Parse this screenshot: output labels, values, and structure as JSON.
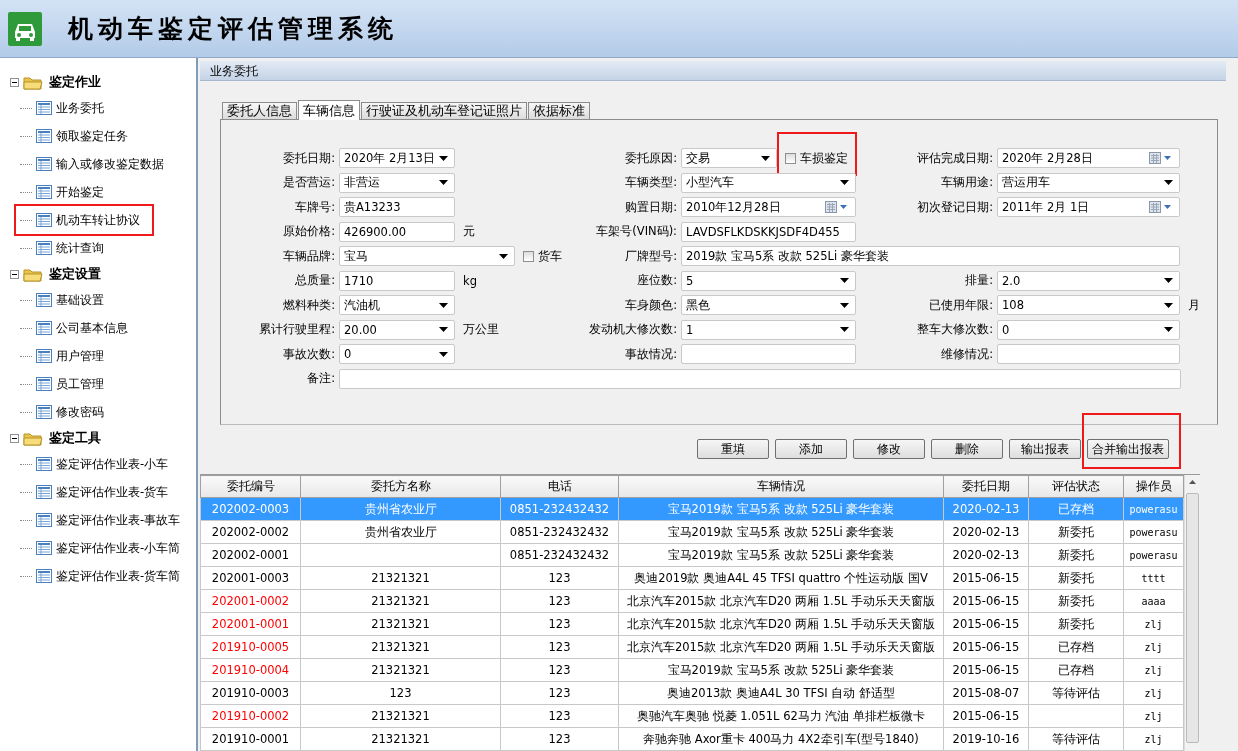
{
  "app": {
    "title": "机动车鉴定评估管理系统"
  },
  "sidebar": {
    "groups": [
      {
        "label": "鉴定作业",
        "expanded": true,
        "children": [
          {
            "label": "业务委托",
            "highlighted": false
          },
          {
            "label": "领取鉴定任务",
            "highlighted": false
          },
          {
            "label": "输入或修改鉴定数据",
            "highlighted": false
          },
          {
            "label": "开始鉴定",
            "highlighted": false
          },
          {
            "label": "机动车转让协议",
            "highlighted": true
          },
          {
            "label": "统计查询",
            "highlighted": false
          }
        ]
      },
      {
        "label": "鉴定设置",
        "expanded": true,
        "children": [
          {
            "label": "基础设置",
            "highlighted": false
          },
          {
            "label": "公司基本信息",
            "highlighted": false
          },
          {
            "label": "用户管理",
            "highlighted": false
          },
          {
            "label": "员工管理",
            "highlighted": false
          },
          {
            "label": "修改密码",
            "highlighted": false
          }
        ]
      },
      {
        "label": "鉴定工具",
        "expanded": true,
        "children": [
          {
            "label": "鉴定评估作业表-小车",
            "highlighted": false
          },
          {
            "label": "鉴定评估作业表-货车",
            "highlighted": false
          },
          {
            "label": "鉴定评估作业表-事故车",
            "highlighted": false
          },
          {
            "label": "鉴定评估作业表-小车简",
            "highlighted": false
          },
          {
            "label": "鉴定评估作业表-货车简",
            "highlighted": false
          }
        ]
      }
    ]
  },
  "panel": {
    "title": "业务委托",
    "tabs": [
      {
        "label": "委托人信息",
        "selected": false
      },
      {
        "label": "车辆信息",
        "selected": true
      },
      {
        "label": "行驶证及机动车登记证照片",
        "selected": false
      },
      {
        "label": "依据标准",
        "selected": false
      }
    ],
    "form": [
      [
        {
          "label": "委托日期:",
          "kind": "combo",
          "value": "2020年 2月13日"
        },
        {
          "label": "委托原因:",
          "kind": "combo",
          "value": "交易",
          "checkbox": {
            "label": "车损鉴定",
            "checked": false,
            "highlighted": true
          }
        },
        {
          "label": "评估完成日期:",
          "kind": "date",
          "value": "2020年 2月28日"
        }
      ],
      [
        {
          "label": "是否营运:",
          "kind": "combo",
          "value": "非营运"
        },
        {
          "label": "车辆类型:",
          "kind": "combo",
          "value": "小型汽车"
        },
        {
          "label": "车辆用途:",
          "kind": "combo",
          "value": "营运用车"
        }
      ],
      [
        {
          "label": "车牌号:",
          "kind": "text",
          "value": "贵A13233"
        },
        {
          "label": "购置日期:",
          "kind": "date",
          "value": "2010年12月28日"
        },
        {
          "label": "初次登记日期:",
          "kind": "date",
          "value": "2011年 2月 1日"
        }
      ],
      [
        {
          "label": "原始价格:",
          "kind": "text",
          "value": "426900.00",
          "unit": "元"
        },
        {
          "label": "车架号(VIN码):",
          "kind": "text",
          "value": "LAVDSFLKDSKKJSDF4D455"
        }
      ],
      [
        {
          "label": "车辆品牌:",
          "kind": "combo",
          "value": "宝马",
          "checkbox": {
            "label": "货车",
            "checked": false,
            "highlighted": false
          }
        },
        {
          "label": "厂牌型号:",
          "kind": "text",
          "value": "2019款 宝马5系 改款 525Li 豪华套装"
        }
      ],
      [
        {
          "label": "总质量:",
          "kind": "text",
          "value": "1710",
          "unit": "kg"
        },
        {
          "label": "座位数:",
          "kind": "combo",
          "value": "5"
        },
        {
          "label": "排量:",
          "kind": "combo",
          "value": "2.0"
        }
      ],
      [
        {
          "label": "燃料种类:",
          "kind": "combo",
          "value": "汽油机"
        },
        {
          "label": "车身颜色:",
          "kind": "combo",
          "value": "黑色"
        },
        {
          "label": "已使用年限:",
          "kind": "combo",
          "value": "108",
          "unit": "月"
        }
      ],
      [
        {
          "label": "累计行驶里程:",
          "kind": "combo",
          "value": "20.00",
          "unit": "万公里"
        },
        {
          "label": "发动机大修次数:",
          "kind": "combo",
          "value": "1"
        },
        {
          "label": "整车大修次数:",
          "kind": "combo",
          "value": "0"
        }
      ],
      [
        {
          "label": "事故次数:",
          "kind": "combo",
          "value": "0"
        },
        {
          "label": "事故情况:",
          "kind": "text"
        },
        {
          "label": "维修情况:",
          "kind": "text"
        }
      ],
      [
        {
          "label": "备注:",
          "kind": "text"
        }
      ]
    ],
    "buttons": [
      {
        "label": "重填",
        "highlighted": false
      },
      {
        "label": "添加",
        "highlighted": false
      },
      {
        "label": "修改",
        "highlighted": false
      },
      {
        "label": "删除",
        "highlighted": false
      },
      {
        "label": "输出报表",
        "highlighted": false
      },
      {
        "label": "合并输出报表",
        "highlighted": true
      }
    ],
    "table": {
      "columns": [
        "委托编号",
        "委托方名称",
        "电话",
        "车辆情况",
        "委托日期",
        "评估状态",
        "操作员"
      ],
      "rows": [
        {
          "selected": true,
          "flagged": false,
          "cells": [
            "202002-0003",
            "贵州省农业厅",
            "0851-232432432",
            "宝马2019款 宝马5系 改款 525Li 豪华套装",
            "2020-02-13",
            "已存档",
            "powerasu"
          ]
        },
        {
          "selected": false,
          "flagged": false,
          "cells": [
            "202002-0002",
            "贵州省农业厅",
            "0851-232432432",
            "宝马2019款 宝马5系 改款 525Li 豪华套装",
            "2020-02-13",
            "新委托",
            "powerasu"
          ]
        },
        {
          "selected": false,
          "flagged": false,
          "cells": [
            "202002-0001",
            "",
            "0851-232432432",
            "宝马2019款 宝马5系 改款 525Li 豪华套装",
            "2020-02-13",
            "新委托",
            "powerasu"
          ]
        },
        {
          "selected": false,
          "flagged": false,
          "cells": [
            "202001-0003",
            "21321321",
            "123",
            "奥迪2019款 奥迪A4L 45 TFSI quattro 个性运动版 国V",
            "2015-06-15",
            "新委托",
            "tttt"
          ]
        },
        {
          "selected": false,
          "flagged": true,
          "cells": [
            "202001-0002",
            "21321321",
            "123",
            "北京汽车2015款 北京汽车D20 两厢 1.5L 手动乐天天窗版",
            "2015-06-15",
            "新委托",
            "aaaa"
          ]
        },
        {
          "selected": false,
          "flagged": true,
          "cells": [
            "202001-0001",
            "21321321",
            "123",
            "北京汽车2015款 北京汽车D20 两厢 1.5L 手动乐天天窗版",
            "2015-06-15",
            "新委托",
            "zlj"
          ]
        },
        {
          "selected": false,
          "flagged": true,
          "cells": [
            "201910-0005",
            "21321321",
            "123",
            "北京汽车2015款 北京汽车D20 两厢 1.5L 手动乐天天窗版",
            "2015-06-15",
            "已存档",
            "zlj"
          ]
        },
        {
          "selected": false,
          "flagged": true,
          "cells": [
            "201910-0004",
            "21321321",
            "123",
            "宝马2019款 宝马5系 改款 525Li 豪华套装",
            "2015-06-15",
            "已存档",
            "zlj"
          ]
        },
        {
          "selected": false,
          "flagged": false,
          "cells": [
            "201910-0003",
            "123",
            "123",
            "奥迪2013款 奥迪A4L 30 TFSI 自动 舒适型",
            "2015-08-07",
            "等待评估",
            "zlj"
          ]
        },
        {
          "selected": false,
          "flagged": true,
          "cells": [
            "201910-0002",
            "21321321",
            "123",
            "奥驰汽车奥驰 悦菱 1.051L 62马力 汽油 单排栏板微卡",
            "2015-06-15",
            "",
            "zlj"
          ]
        },
        {
          "selected": false,
          "flagged": false,
          "cells": [
            "201910-0001",
            "21321321",
            "123",
            "奔驰奔驰 Axor重卡 400马力 4X2牵引车(型号1840)",
            "2019-10-16",
            "等待评估",
            "zlj"
          ]
        }
      ]
    }
  }
}
